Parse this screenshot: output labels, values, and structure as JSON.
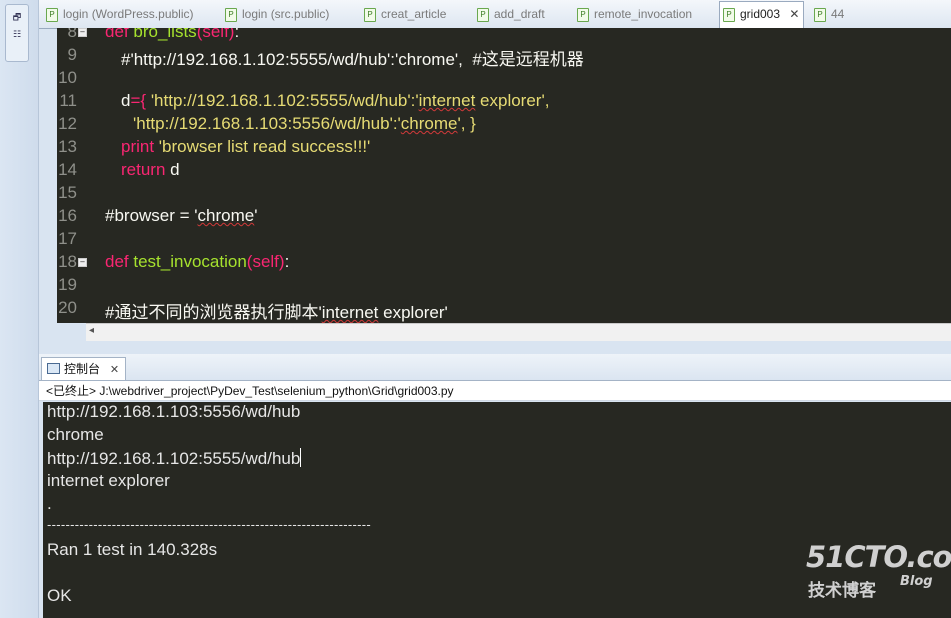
{
  "editor_tabs": [
    {
      "label": "login (WordPress.public)",
      "active": false
    },
    {
      "label": "login (src.public)",
      "active": false
    },
    {
      "label": "creat_article",
      "active": false
    },
    {
      "label": "add_draft",
      "active": false
    },
    {
      "label": "remote_invocation",
      "active": false
    },
    {
      "label": "grid003",
      "active": true,
      "close": "✕"
    },
    {
      "label": "44",
      "active": false
    }
  ],
  "code": {
    "line_numbers": [
      "8",
      "9",
      "10",
      "11",
      "12",
      "13",
      "14",
      "15",
      "16",
      "17",
      "18",
      "19",
      "20"
    ],
    "l8": {
      "kw": "def",
      "fn": "bro_lists",
      "args": "(self)",
      "colon": ":"
    },
    "l9": "#'http://192.168.1.102:5555/wd/hub':'chrome',  #这是远程机器",
    "l11": {
      "var": "d",
      "op": "={ ",
      "s1a": "'http://192.168.1.102:5555/wd/hub':'",
      "s1b": "internet",
      "s1c": " explorer',"
    },
    "l12": {
      "s2a": "'http://192.168.1.103:5556/wd/hub':'",
      "s2b": "chrome",
      "s2c": "', }"
    },
    "l13": {
      "kw": "print",
      "str": " 'browser list read success!!!'"
    },
    "l14": {
      "kw": "return",
      "rest": " d"
    },
    "l16": {
      "pre": "#browser = '",
      "sq": "chrome",
      "post": "'"
    },
    "l18": {
      "kw": "def",
      "fn": " test_invocation",
      "args": "(self)",
      "colon": ":"
    },
    "l20": {
      "pre": "#通过不同的浏览器执行脚本'",
      "sq": "internet",
      "post": " explorer'"
    }
  },
  "console": {
    "tab_label": "控制台",
    "tab_close": "✕",
    "status": "<已终止> J:\\webdriver_project\\PyDev_Test\\selenium_python\\Grid\\grid003.py",
    "lines": [
      "http://192.168.1.103:5556/wd/hub",
      "chrome",
      "http://192.168.1.102:5555/wd/hub",
      "internet explorer",
      ".",
      "----------------------------------------------------------------------",
      "Ran 1 test in 140.328s",
      "",
      "OK"
    ]
  },
  "watermark": {
    "main": "51CTO.com",
    "sub": "技术博客",
    "blog": "Blog"
  },
  "colors": {
    "editor_bg": "#272822",
    "keyword": "#f92672",
    "function": "#a6e22e",
    "string": "#e6db74",
    "text": "#f8f8f2"
  }
}
